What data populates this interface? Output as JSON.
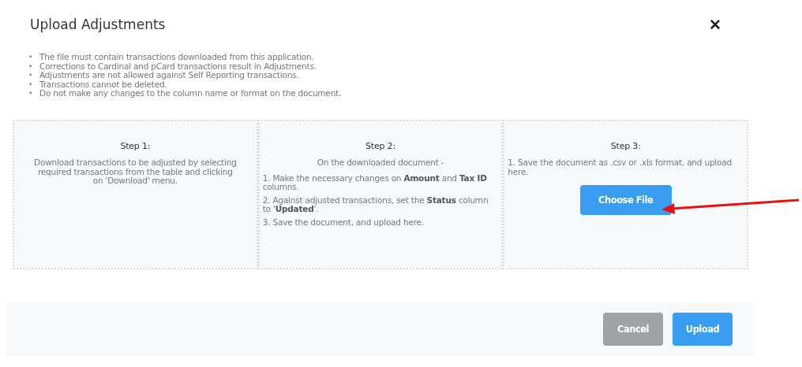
{
  "dialog": {
    "title": "Upload Adjustments",
    "close": "✕"
  },
  "notes": [
    {
      "bullet": "•",
      "text": "The file must contain transactions downloaded from this application."
    },
    {
      "bullet": "•",
      "text": "Corrections to Cardinal and pCard transactions result in Adjustments."
    },
    {
      "bullet": "•",
      "text": "Adjustments are not allowed against Self Reporting transactions."
    },
    {
      "bullet": "•",
      "text": "Transactions cannot be deleted."
    },
    {
      "bullet": "•",
      "text": "Do not make any changes to the column name or format on the document."
    }
  ],
  "steps": [
    {
      "title": "Step 1:",
      "intro": "Download transactions to be adjusted by selecting required transactions from the table and clicking on 'Download' menu."
    },
    {
      "title": "Step 2:",
      "intro": "On the downloaded document -",
      "lines": [
        "1. Make the necessary changes on **Amount** and **Tax ID** columns.",
        "2. Against adjusted transactions, set the **Status** column to '**Updated**'.",
        "3. Save the document, and upload here."
      ]
    },
    {
      "title": "Step 3:",
      "lines": [
        "1. Save the document as .csv or .xls format, and upload here."
      ],
      "button": "Choose File"
    }
  ],
  "buttons": [
    {
      "label": "Cancel",
      "kind": "secondary"
    },
    {
      "label": "Upload",
      "kind": "primary"
    }
  ]
}
